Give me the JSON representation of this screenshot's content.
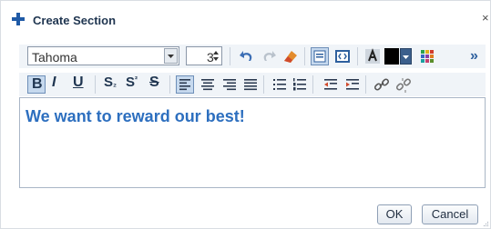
{
  "dialog": {
    "title": "Create Section",
    "close_glyph": "×"
  },
  "toolbar": {
    "font_family": "Tahoma",
    "font_size": "3",
    "more_glyph": "»",
    "bold_label": "B",
    "italic_label": "I",
    "underline_label": "U",
    "subscript_label": "S",
    "superscript_label": "S",
    "strike_label": "S",
    "text_color": "#000000",
    "accent_color": "#2d6fbf"
  },
  "editor": {
    "content": "We want to reward our best!"
  },
  "buttons": {
    "ok_label": "OK",
    "cancel_label": "Cancel"
  }
}
